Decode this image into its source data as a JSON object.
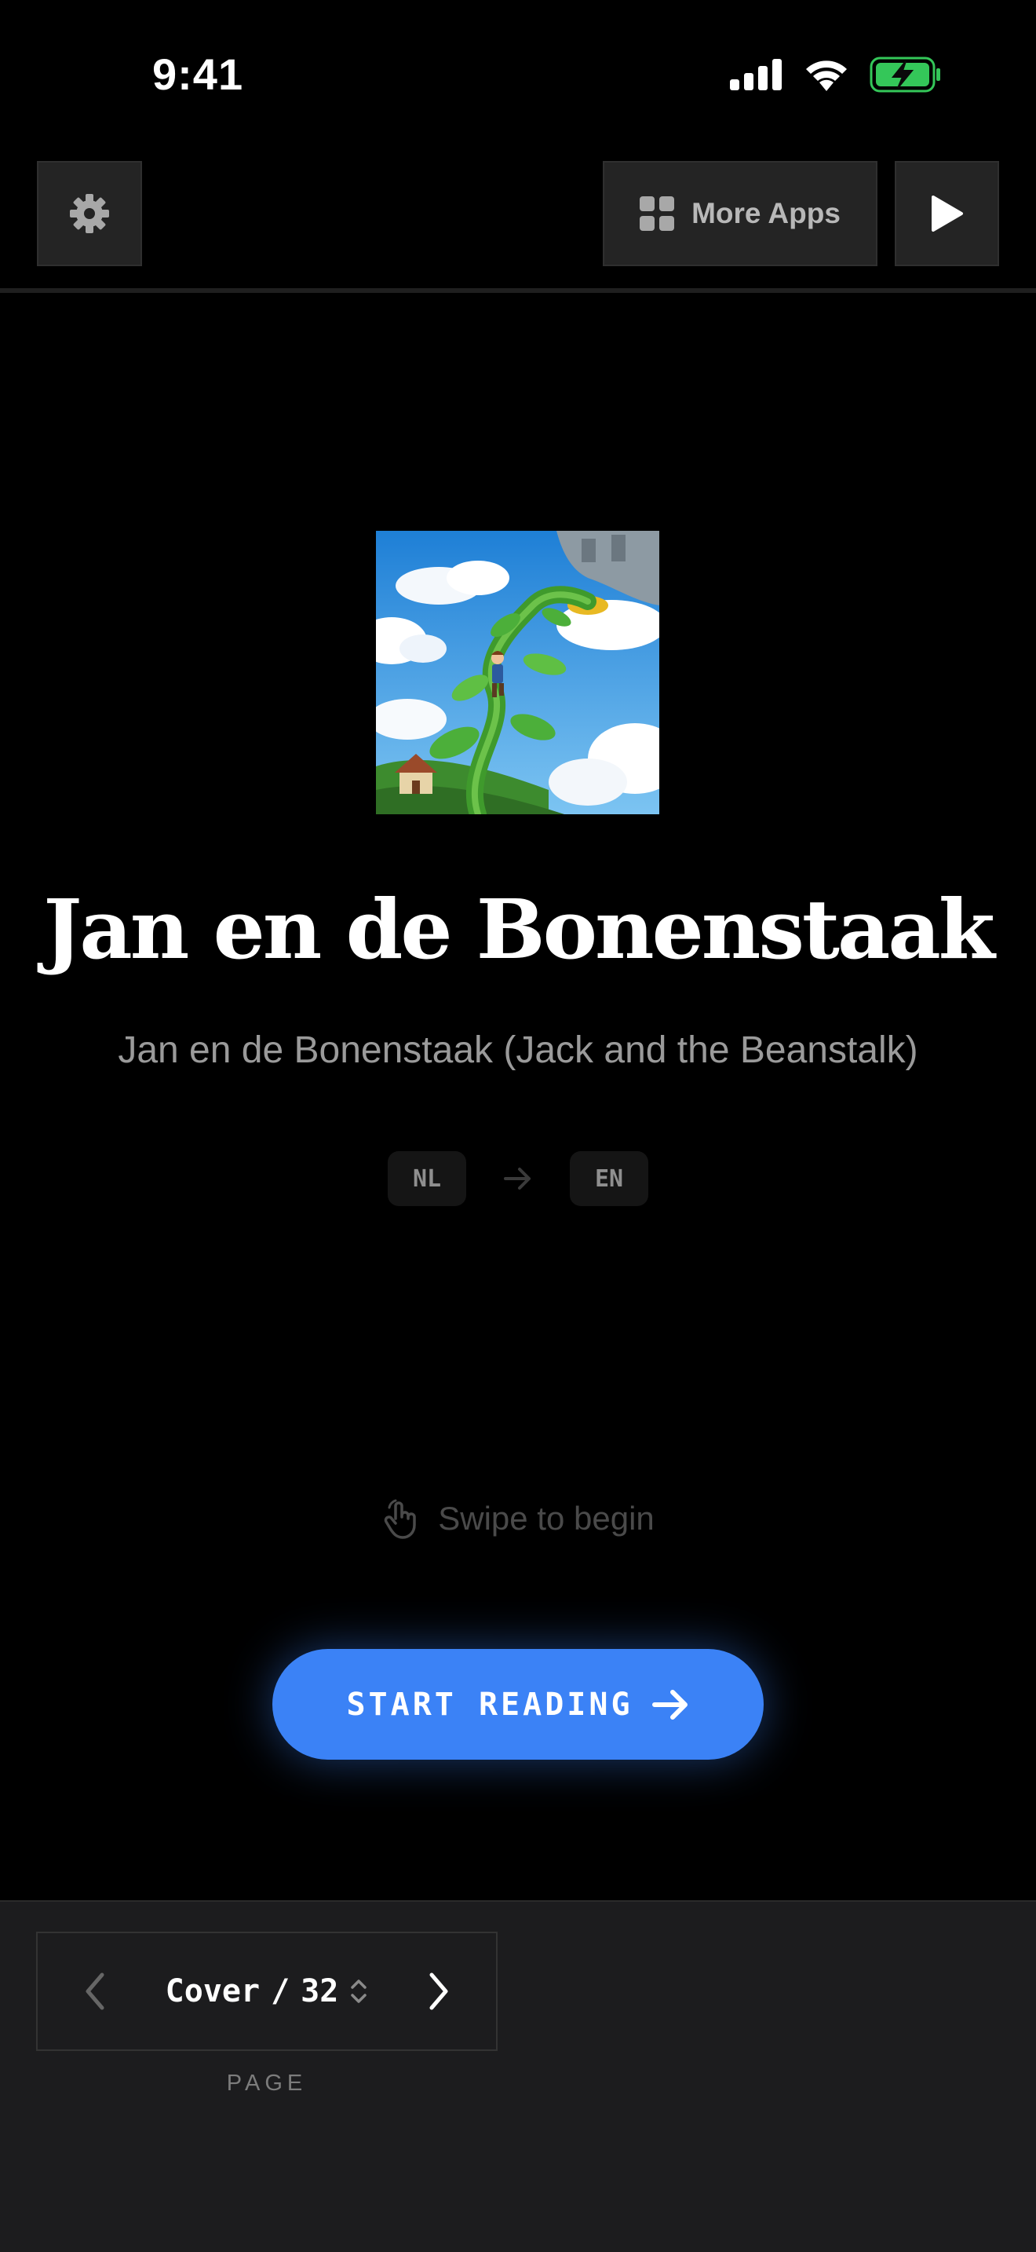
{
  "status_bar": {
    "time": "9:41"
  },
  "toolbar": {
    "more_apps_label": "More Apps"
  },
  "book": {
    "title": "Jan en de Bonenstaak",
    "subtitle": "Jan en de Bonenstaak (Jack and the Beanstalk)",
    "source_language": "NL",
    "target_language": "EN"
  },
  "swipe_hint": "Swipe to begin",
  "start_button_label": "START READING",
  "pager": {
    "current": "Cover",
    "separator": "/",
    "total": "32",
    "label": "PAGE"
  },
  "colors": {
    "accent": "#3b82f6",
    "battery": "#34c759",
    "background": "#000000",
    "panel": "#1c1c1e"
  },
  "icons": [
    "signal-icon",
    "wifi-icon",
    "battery-charging-icon",
    "gear-icon",
    "grid-icon",
    "play-icon",
    "arrow-right-icon",
    "hand-swipe-icon",
    "chevron-left-icon",
    "chevron-right-icon",
    "chevron-updown-icon"
  ]
}
